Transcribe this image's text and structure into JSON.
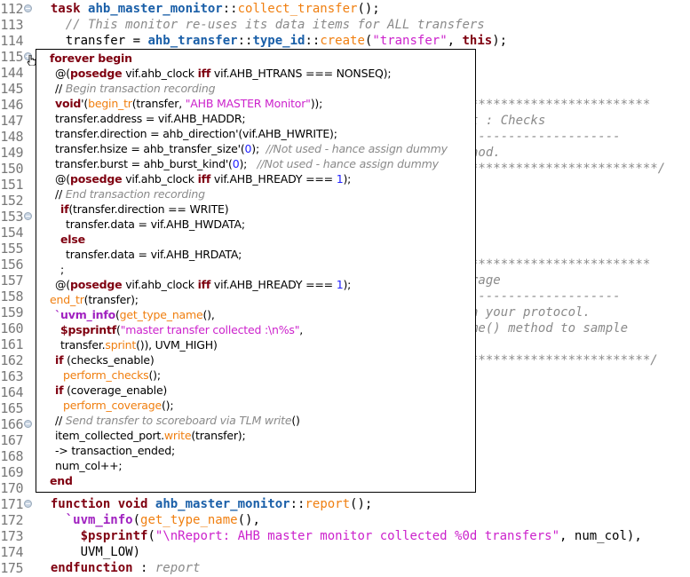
{
  "editor": {
    "line_numbers": [
      "112",
      "113",
      "114",
      "115",
      "144",
      "145",
      "146",
      "147",
      "148",
      "149",
      "150",
      "151",
      "152",
      "153",
      "154",
      "155",
      "156",
      "157",
      "158",
      "159",
      "160",
      "161",
      "162",
      "163",
      "164",
      "165",
      "166",
      "167",
      "168",
      "169",
      "170",
      "171",
      "172",
      "173",
      "174",
      "175"
    ],
    "fold_markers": {
      "112": "minus",
      "115": "plus",
      "153": "minus",
      "166": "minus",
      "171": "minus"
    },
    "visible_code": {
      "112": [
        [
          "  ",
          ""
        ],
        [
          "task",
          "kw"
        ],
        [
          " ",
          ""
        ],
        [
          "ahb_master_monitor",
          "id"
        ],
        [
          "::",
          ""
        ],
        [
          "collect_transfer",
          "fn"
        ],
        [
          "();",
          ""
        ]
      ],
      "113": [
        [
          "    ",
          ""
        ],
        [
          "// This monitor re-uses its data items for ALL transfers",
          "cm"
        ]
      ],
      "114": [
        [
          "    transfer = ",
          ""
        ],
        [
          "ahb_transfer",
          "id"
        ],
        [
          "::",
          ""
        ],
        [
          "type_id",
          "id"
        ],
        [
          "::",
          ""
        ],
        [
          "create",
          "fn"
        ],
        [
          "(",
          ""
        ],
        [
          "\"transfer\"",
          "str"
        ],
        [
          ", ",
          ""
        ],
        [
          "this",
          "kw"
        ],
        [
          ");",
          ""
        ]
      ],
      "171": [
        [
          "  ",
          ""
        ],
        [
          "function",
          "kw"
        ],
        [
          " ",
          ""
        ],
        [
          "void",
          "kw"
        ],
        [
          " ",
          ""
        ],
        [
          "ahb_master_monitor",
          "id"
        ],
        [
          "::",
          ""
        ],
        [
          "report",
          "fn"
        ],
        [
          "();",
          ""
        ]
      ],
      "172": [
        [
          "    ",
          ""
        ],
        [
          "`uvm_info",
          "mac"
        ],
        [
          "(",
          ""
        ],
        [
          "get_type_name",
          "fn"
        ],
        [
          "(),",
          ""
        ]
      ],
      "173": [
        [
          "      ",
          ""
        ],
        [
          "$psprintf",
          "kw"
        ],
        [
          "(",
          ""
        ],
        [
          "\"\\nReport: AHB master monitor collected %0d transfers\"",
          "str"
        ],
        [
          ", num_col),",
          ""
        ]
      ],
      "174": [
        [
          "      UVM_LOW)",
          ""
        ]
      ],
      "175": [
        [
          "  ",
          ""
        ],
        [
          "endfunction",
          "kw"
        ],
        [
          " : ",
          ""
        ],
        [
          "report",
          "cm"
        ]
      ]
    },
    "right_fragments": {
      "146": "************************",
      "147": "t : Checks",
      "148": "--------------------",
      "149": "hod.",
      "150": "*************************/",
      "156": "************************",
      "157": "rage",
      "158": "--------------------",
      "159": "n your protocol.",
      "160": "me() method to sample",
      "162": "************************/"
    }
  },
  "hover_popup": {
    "lines": [
      [
        [
          "forever begin",
          "kw"
        ]
      ],
      [
        [
          "@(",
          ""
        ],
        [
          "posedge",
          "kw"
        ],
        [
          " vif.ahb_clock ",
          ""
        ],
        [
          "iff",
          "kw"
        ],
        [
          " vif.AHB_HTRANS === NONSEQ);",
          ""
        ]
      ],
      [
        [
          "// ",
          ""
        ],
        [
          "Begin transaction recording",
          "cm"
        ]
      ],
      [
        [
          "void",
          "kw"
        ],
        [
          "'(",
          ""
        ],
        [
          "begin_tr",
          "fn"
        ],
        [
          "(transfer, ",
          ""
        ],
        [
          "\"AHB MASTER Monitor\"",
          "str"
        ],
        [
          "));",
          ""
        ]
      ],
      [
        [
          "transfer.address = vif.AHB_HADDR;",
          ""
        ]
      ],
      [
        [
          "transfer.direction = ahb_direction'(vif.AHB_HWRITE);",
          ""
        ]
      ],
      [
        [
          "transfer.hsize = ahb_transfer_size'(",
          ""
        ],
        [
          "0",
          "num"
        ],
        [
          ");  ",
          ""
        ],
        [
          "//Not used - hance assign dummy",
          "cm"
        ]
      ],
      [
        [
          "transfer.burst = ahb_burst_kind'(",
          ""
        ],
        [
          "0",
          "num"
        ],
        [
          ");   ",
          ""
        ],
        [
          "//Not used - hance assign dummy",
          "cm"
        ]
      ],
      [
        [
          "@(",
          ""
        ],
        [
          "posedge",
          "kw"
        ],
        [
          " vif.ahb_clock ",
          ""
        ],
        [
          "iff",
          "kw"
        ],
        [
          " vif.AHB_HREADY === ",
          ""
        ],
        [
          "1",
          "num"
        ],
        [
          ");",
          ""
        ]
      ],
      [
        [
          "// ",
          ""
        ],
        [
          "End transaction recording",
          "cm"
        ]
      ],
      [
        [
          "if",
          "kw"
        ],
        [
          "(transfer.direction == WRITE)",
          ""
        ]
      ],
      [
        [
          "transfer.data = vif.AHB_HWDATA;",
          ""
        ]
      ],
      [
        [
          "else",
          "kw"
        ]
      ],
      [
        [
          "transfer.data = vif.AHB_HRDATA;",
          ""
        ]
      ],
      [
        [
          ";",
          ""
        ]
      ],
      [
        [
          "@(",
          ""
        ],
        [
          "posedge",
          "kw"
        ],
        [
          " vif.ahb_clock ",
          ""
        ],
        [
          "iff",
          "kw"
        ],
        [
          " vif.AHB_HREADY === ",
          ""
        ],
        [
          "1",
          "num"
        ],
        [
          ");",
          ""
        ]
      ],
      [
        [
          "end_tr",
          "fn"
        ],
        [
          "(transfer);",
          ""
        ]
      ],
      [
        [
          "`uvm_info",
          "mac"
        ],
        [
          "(",
          ""
        ],
        [
          "get_type_name",
          "fn"
        ],
        [
          "(),",
          ""
        ]
      ],
      [
        [
          "$psprintf",
          "kw"
        ],
        [
          "(",
          ""
        ],
        [
          "\"master transfer collected :\\n%s\"",
          "str"
        ],
        [
          ",",
          ""
        ]
      ],
      [
        [
          "transfer.",
          ""
        ],
        [
          "sprint",
          "fn"
        ],
        [
          "()), UVM_HIGH)",
          ""
        ]
      ],
      [
        [
          "if",
          "kw"
        ],
        [
          " (checks_enable)",
          ""
        ]
      ],
      [
        [
          "perform_checks",
          "fn"
        ],
        [
          "();",
          ""
        ]
      ],
      [
        [
          "if",
          "kw"
        ],
        [
          " (coverage_enable)",
          ""
        ]
      ],
      [
        [
          "perform_coverage",
          "fn"
        ],
        [
          "();",
          ""
        ]
      ],
      [
        [
          "// ",
          ""
        ],
        [
          "Send transfer to scoreboard via TLM write",
          "cm"
        ],
        [
          "()",
          ""
        ]
      ],
      [
        [
          "item_collected_port.",
          ""
        ],
        [
          "write",
          "fn"
        ],
        [
          "(transfer);",
          ""
        ]
      ],
      [
        [
          "-> transaction_ended;",
          ""
        ]
      ],
      [
        [
          "num_col++;",
          ""
        ]
      ],
      [
        [
          "end",
          "kw"
        ]
      ]
    ]
  },
  "colors": {
    "keyword": "#7f0010",
    "identifier": "#1a5fa8",
    "function": "#f07f10",
    "string": "#cc22cc",
    "comment": "#8a8a8a",
    "number": "#2222ff"
  }
}
